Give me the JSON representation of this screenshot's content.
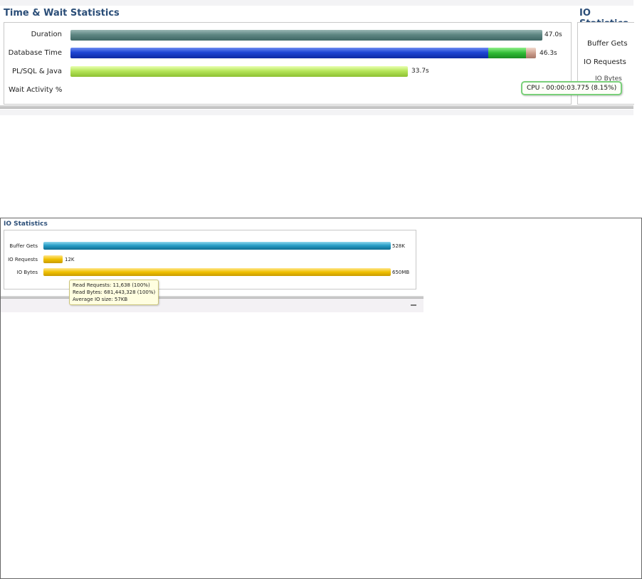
{
  "top": {
    "title": "Time & Wait Statistics",
    "io_title": "IO Statistics",
    "rows": [
      {
        "label": "Duration",
        "value": "47.0s"
      },
      {
        "label": "Database Time",
        "value": "46.3s"
      },
      {
        "label": "PL/SQL & Java",
        "value": "33.7s"
      },
      {
        "label": "Wait Activity %"
      }
    ],
    "io_labels": [
      "Buffer Gets",
      "IO Requests",
      "IO Bytes"
    ],
    "tooltip": "CPU - 00:00:03.775 (8.15%)",
    "colors": {
      "duration": "#5f8783",
      "database_time": "#1d45d4",
      "cpu": "#2fbb35",
      "plsql": "#b6e65a"
    }
  },
  "bottom": {
    "title": "IO Statistics",
    "rows": [
      {
        "label": "Buffer Gets",
        "value": "528K"
      },
      {
        "label": "IO Requests",
        "value": "12K"
      },
      {
        "label": "IO Bytes",
        "value": "650MB"
      }
    ],
    "tooltip": {
      "line1": "Read Requests: 11,638 (100%)",
      "line2": "Read Bytes: 681,443,328 (100%)",
      "line3": "Average IO size: 57KB"
    },
    "colors": {
      "buffer_gets": "#2aa0c8",
      "io": "#f0c000"
    }
  }
}
